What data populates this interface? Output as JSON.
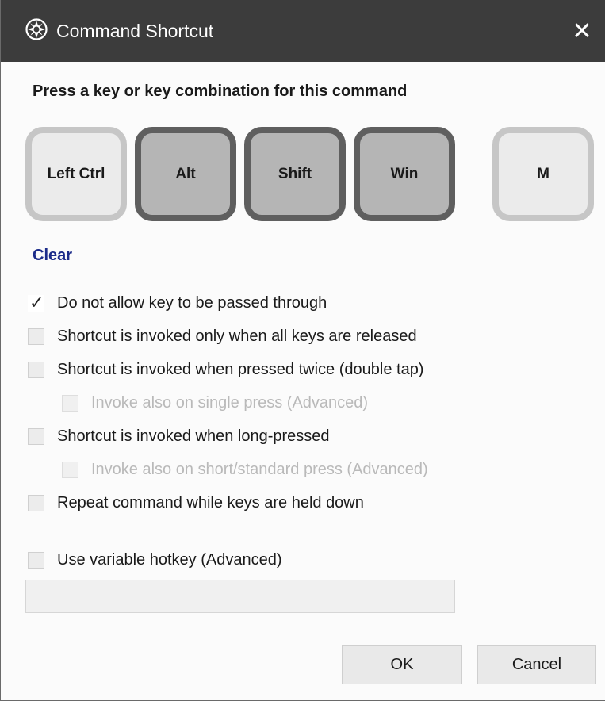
{
  "window": {
    "title": "Command Shortcut",
    "app_icon": "gear-icon",
    "close_glyph": "✕"
  },
  "heading": "Press a key or key combination for this command",
  "keys": [
    {
      "label": "Left Ctrl",
      "state": "off"
    },
    {
      "label": "Alt",
      "state": "on"
    },
    {
      "label": "Shift",
      "state": "on"
    },
    {
      "label": "Win",
      "state": "on"
    },
    {
      "label": "M",
      "state": "off"
    }
  ],
  "clear_label": "Clear",
  "options": [
    {
      "label": "Do not allow key to be passed through",
      "checked": true,
      "enabled": true
    },
    {
      "label": "Shortcut is invoked only when all keys are released",
      "checked": false,
      "enabled": true
    },
    {
      "label": "Shortcut is invoked when pressed twice (double tap)",
      "checked": false,
      "enabled": true
    },
    {
      "label": "Invoke also on single press (Advanced)",
      "checked": false,
      "enabled": false
    },
    {
      "label": "Shortcut is invoked when long-pressed",
      "checked": false,
      "enabled": true
    },
    {
      "label": "Invoke also on short/standard press (Advanced)",
      "checked": false,
      "enabled": false
    },
    {
      "label": "Repeat command while keys are held down",
      "checked": false,
      "enabled": true
    },
    {
      "label": "Use variable hotkey (Advanced)",
      "checked": false,
      "enabled": true
    }
  ],
  "variable_hotkey_value": "",
  "buttons": {
    "ok": "OK",
    "cancel": "Cancel"
  },
  "colors": {
    "titlebar": "#3c3c3c",
    "key_active_border": "#5f5f5f",
    "key_inactive_border": "#c6c6c6",
    "link": "#1c2c8a"
  }
}
